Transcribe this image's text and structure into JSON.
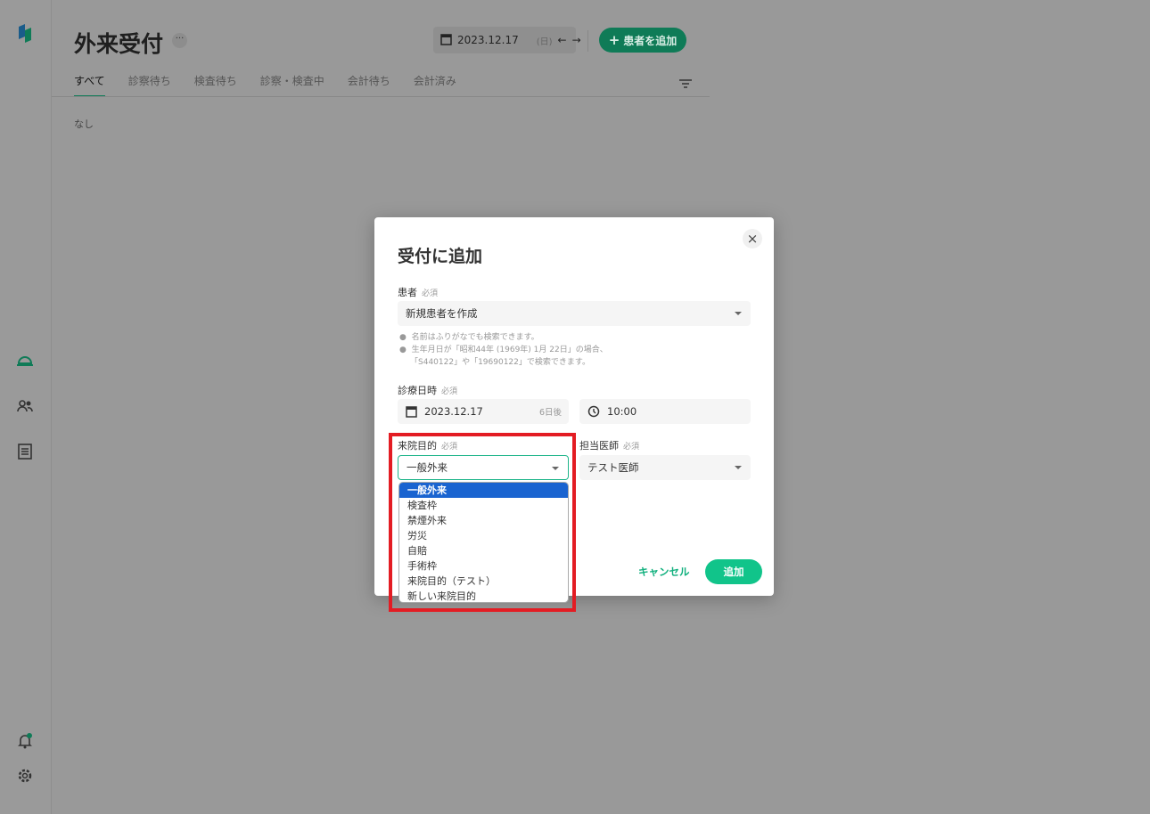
{
  "header": {
    "title": "外来受付",
    "more_label": "···",
    "date": "2023.12.17",
    "weekday": "(日)",
    "add_patient": "患者を追加"
  },
  "tabs": [
    {
      "label": "すべて",
      "active": true
    },
    {
      "label": "診察待ち"
    },
    {
      "label": "検査待ち"
    },
    {
      "label": "診察・検査中"
    },
    {
      "label": "会計待ち"
    },
    {
      "label": "会計済み"
    }
  ],
  "empty_text": "なし",
  "modal": {
    "title": "受付に追加",
    "close": "×",
    "patient": {
      "label": "患者",
      "required": "必須",
      "value": "新規患者を作成",
      "hints": [
        "名前はふりがなでも検索できます。",
        "生年月日が「昭和44年 (1969年) 1月 22日」の場合、",
        "「S440122」や「19690122」で検索できます。"
      ]
    },
    "datetime": {
      "label": "診療日時",
      "required": "必須",
      "date": "2023.12.17",
      "relative": "6日後",
      "time": "10:00"
    },
    "purpose": {
      "label": "来院目的",
      "required": "必須",
      "value": "一般外来",
      "options": [
        "一般外来",
        "検査枠",
        "禁煙外来",
        "労災",
        "自賠",
        "手術枠",
        "来院目的（テスト）",
        "新しい来院目的"
      ],
      "selected_index": 0
    },
    "doctor": {
      "label": "担当医師",
      "required": "必須",
      "value": "テスト医師"
    },
    "cancel": "キャンセル",
    "submit": "追加"
  },
  "colors": {
    "accent": "#11c48a",
    "highlight": "#e31c23",
    "selected_option": "#1a64d0"
  }
}
